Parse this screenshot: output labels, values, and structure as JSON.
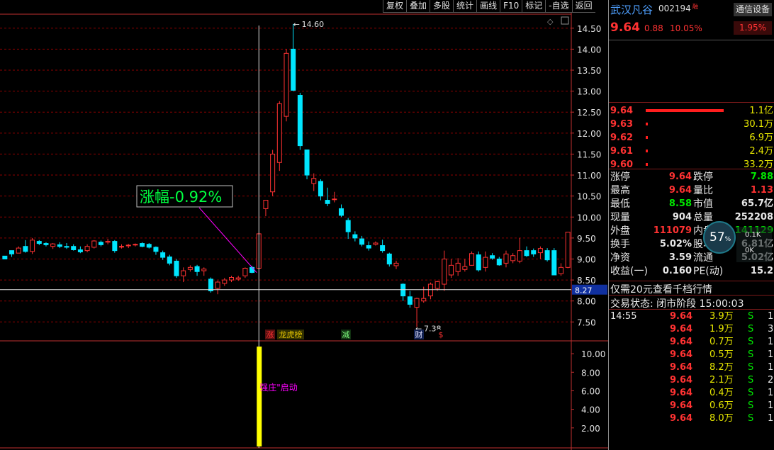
{
  "toolbar": {
    "items": [
      "复权",
      "叠加",
      "多股",
      "统计",
      "画线",
      "F10",
      "标记",
      "-自选",
      "返回"
    ]
  },
  "chart": {
    "price_ticks": [
      "14.50",
      "14.00",
      "13.50",
      "13.00",
      "12.50",
      "12.00",
      "11.50",
      "11.00",
      "10.50",
      "10.00",
      "9.50",
      "9.00",
      "8.50",
      "8.00",
      "7.50"
    ],
    "indicator_ticks": [
      "10.00",
      "8.00",
      "6.00",
      "4.00",
      "2.00"
    ],
    "cursor_price": "8.27",
    "high_label": "14.60",
    "low_label": "7.38",
    "tooltip": "涨幅-0.92%",
    "signal_text": "强庄\"启动",
    "markers": [
      {
        "text": "涨",
        "color": "#ff3232",
        "bg": "#5a1010"
      },
      {
        "text": "龙虎榜",
        "color": "#e0c000",
        "bg": "#303000"
      },
      {
        "text": "减",
        "color": "#80ff80",
        "bg": "#103010"
      },
      {
        "text": "财",
        "color": "#e0e0ff",
        "bg": "#102050"
      },
      {
        "text": "$",
        "color": "#ff3232",
        "bg": "#000000"
      }
    ],
    "colors": {
      "up": "#ff3232",
      "down": "#00e6ff",
      "grid": "#8b0000",
      "bar": "#ffff00",
      "magenta": "#ff00ff"
    },
    "chart_data": {
      "type": "candlestick",
      "candles": [
        [
          9.07,
          9.07,
          9.0,
          9.0
        ],
        [
          9.2,
          9.2,
          9.05,
          9.12
        ],
        [
          9.14,
          9.3,
          9.14,
          9.26
        ],
        [
          9.3,
          9.45,
          9.15,
          9.18
        ],
        [
          9.18,
          9.5,
          9.12,
          9.45
        ],
        [
          9.42,
          9.45,
          9.33,
          9.37
        ],
        [
          9.37,
          9.4,
          9.3,
          9.34
        ],
        [
          9.3,
          9.38,
          9.24,
          9.36
        ],
        [
          9.34,
          9.4,
          9.26,
          9.3
        ],
        [
          9.3,
          9.38,
          9.24,
          9.28
        ],
        [
          9.3,
          9.35,
          9.2,
          9.22
        ],
        [
          9.22,
          9.3,
          9.14,
          9.17
        ],
        [
          9.2,
          9.35,
          9.16,
          9.3
        ],
        [
          9.28,
          9.45,
          9.25,
          9.43
        ],
        [
          9.4,
          9.44,
          9.3,
          9.34
        ],
        [
          9.4,
          9.48,
          9.35,
          9.42
        ],
        [
          9.42,
          9.45,
          9.15,
          9.2
        ],
        [
          9.3,
          9.35,
          9.25,
          9.3
        ],
        [
          9.32,
          9.36,
          9.26,
          9.33
        ],
        [
          9.34,
          9.37,
          9.3,
          9.35
        ],
        [
          9.37,
          9.4,
          9.28,
          9.3
        ],
        [
          9.35,
          9.38,
          9.25,
          9.28
        ],
        [
          9.28,
          9.3,
          9.1,
          9.18
        ],
        [
          9.15,
          9.2,
          8.98,
          9.04
        ],
        [
          9.05,
          9.1,
          8.85,
          8.9
        ],
        [
          8.95,
          9.0,
          8.55,
          8.6
        ],
        [
          8.6,
          8.8,
          8.45,
          8.72
        ],
        [
          8.75,
          8.85,
          8.7,
          8.8
        ],
        [
          8.82,
          8.86,
          8.6,
          8.7
        ],
        [
          8.72,
          8.8,
          8.6,
          8.76
        ],
        [
          8.52,
          8.56,
          8.2,
          8.24
        ],
        [
          8.3,
          8.48,
          8.16,
          8.45
        ],
        [
          8.42,
          8.55,
          8.36,
          8.5
        ],
        [
          8.5,
          8.6,
          8.45,
          8.56
        ],
        [
          8.52,
          8.6,
          8.48,
          8.55
        ],
        [
          8.6,
          8.8,
          8.55,
          8.78
        ],
        [
          8.8,
          8.84,
          8.66,
          8.68
        ],
        [
          8.78,
          9.62,
          8.75,
          9.6
        ],
        [
          10.2,
          10.4,
          10.02,
          10.4
        ],
        [
          10.6,
          11.6,
          10.5,
          11.5
        ],
        [
          11.3,
          12.76,
          11.1,
          12.7
        ],
        [
          12.4,
          14.0,
          12.28,
          13.9
        ],
        [
          14.0,
          14.6,
          13.0,
          13.02
        ],
        [
          12.9,
          12.96,
          11.6,
          11.7
        ],
        [
          11.6,
          11.6,
          10.9,
          11.0
        ],
        [
          10.8,
          11.04,
          10.62,
          10.92
        ],
        [
          10.85,
          10.9,
          10.4,
          10.5
        ],
        [
          10.4,
          10.7,
          10.26,
          10.32
        ],
        [
          10.42,
          10.6,
          10.35,
          10.43
        ],
        [
          10.2,
          10.3,
          10.0,
          10.04
        ],
        [
          9.92,
          9.98,
          9.48,
          9.65
        ],
        [
          9.58,
          9.66,
          9.42,
          9.5
        ],
        [
          9.48,
          9.55,
          9.3,
          9.35
        ],
        [
          9.32,
          9.42,
          9.2,
          9.26
        ],
        [
          9.35,
          9.42,
          9.32,
          9.38
        ],
        [
          9.32,
          9.46,
          9.15,
          9.2
        ],
        [
          9.12,
          9.15,
          8.82,
          8.88
        ],
        [
          8.84,
          8.96,
          8.76,
          8.9
        ],
        [
          8.4,
          8.42,
          8.0,
          8.12
        ],
        [
          8.1,
          8.24,
          7.84,
          7.92
        ],
        [
          7.85,
          8.08,
          7.38,
          8.06
        ],
        [
          8.0,
          8.34,
          7.96,
          8.06
        ],
        [
          8.12,
          8.44,
          8.04,
          8.4
        ],
        [
          8.3,
          8.48,
          8.24,
          8.46
        ],
        [
          8.4,
          9.2,
          8.24,
          9.0
        ],
        [
          8.62,
          9.0,
          8.55,
          8.85
        ],
        [
          8.7,
          9.02,
          8.6,
          8.9
        ],
        [
          8.75,
          9.0,
          8.7,
          8.82
        ],
        [
          8.85,
          9.18,
          8.84,
          9.13
        ],
        [
          9.1,
          9.18,
          8.7,
          8.74
        ],
        [
          8.8,
          9.18,
          8.7,
          9.04
        ],
        [
          9.08,
          9.14,
          8.98,
          9.02
        ],
        [
          9.0,
          9.05,
          8.84,
          8.86
        ],
        [
          8.9,
          9.2,
          8.8,
          9.12
        ],
        [
          8.96,
          9.14,
          8.9,
          9.08
        ],
        [
          8.95,
          9.5,
          8.9,
          9.2
        ],
        [
          9.2,
          9.3,
          9.05,
          9.08
        ],
        [
          9.2,
          9.25,
          9.05,
          9.12
        ],
        [
          9.15,
          9.3,
          9.0,
          9.25
        ],
        [
          9.2,
          9.26,
          8.94,
          8.98
        ],
        [
          9.2,
          9.26,
          8.62,
          8.62
        ],
        [
          8.65,
          8.9,
          8.6,
          8.8
        ],
        [
          8.8,
          9.64,
          8.78,
          9.64
        ]
      ],
      "cursor_index": 37,
      "indicator": {
        "bar_index": 37,
        "bar_value": 10,
        "ylim": [
          0,
          11
        ]
      },
      "ylim": [
        7.1,
        14.8
      ]
    }
  },
  "quote": {
    "name": "武汉凡谷",
    "code": "002194",
    "tag": "融",
    "industry": "通信设备",
    "industry_pct": "1.95%",
    "price": "9.64",
    "change": "0.88",
    "change_pct": "10.05%"
  },
  "orderbook": [
    {
      "price": "9.64",
      "bar": 1.0,
      "vol": "1.1亿"
    },
    {
      "price": "9.63",
      "bar": 0.0,
      "vol": "30.1万"
    },
    {
      "price": "9.62",
      "bar": 0.0,
      "vol": "6.9万"
    },
    {
      "price": "9.61",
      "bar": 0.0,
      "vol": "2.4万"
    },
    {
      "price": "9.60",
      "bar": 0.0,
      "vol": "33.2万"
    }
  ],
  "stats": [
    {
      "l1": "涨停",
      "v1": "9.64",
      "c1": "r",
      "l2": "跌停",
      "v2": "7.88",
      "c2": "g"
    },
    {
      "l1": "最高",
      "v1": "9.64",
      "c1": "r",
      "l2": "量比",
      "v2": "1.13",
      "c2": "r"
    },
    {
      "l1": "最低",
      "v1": "8.58",
      "c1": "g",
      "l2": "市值",
      "v2": "65.7亿",
      "c2": "w"
    },
    {
      "l1": "现量",
      "v1": "904",
      "c1": "w",
      "l2": "总量",
      "v2": "252208",
      "c2": "w"
    },
    {
      "l1": "外盘",
      "v1": "111079",
      "c1": "r",
      "l2": "内盘",
      "v2": "141129",
      "c2": "g"
    },
    {
      "l1": "换手",
      "v1": "5.02%",
      "c1": "w",
      "l2": "股本",
      "v2": "6.81亿",
      "c2": "w"
    },
    {
      "l1": "净资",
      "v1": "3.59",
      "c1": "w",
      "l2": "流通",
      "v2": "5.02亿",
      "c2": "w"
    },
    {
      "l1": "收益(一)",
      "v1": "0.160",
      "c1": "w",
      "l2": "PE(动)",
      "v2": "15.2",
      "c2": "w"
    }
  ],
  "gauge": {
    "value": "57",
    "unit": "%",
    "up": "0.1K",
    "down": "0K"
  },
  "promo": "仅需20元查看千档行情",
  "status": "交易状态: 闭市阶段 15:00:03",
  "ticks": [
    {
      "time": "14:55",
      "price": "9.64",
      "vol": "3.9万",
      "bs": "S",
      "n": "1"
    },
    {
      "time": "",
      "price": "9.64",
      "vol": "1.9万",
      "bs": "S",
      "n": "3"
    },
    {
      "time": "",
      "price": "9.64",
      "vol": "0.7万",
      "bs": "S",
      "n": "1"
    },
    {
      "time": "",
      "price": "9.64",
      "vol": "0.5万",
      "bs": "S",
      "n": "1"
    },
    {
      "time": "",
      "price": "9.64",
      "vol": "8.2万",
      "bs": "S",
      "n": "1"
    },
    {
      "time": "",
      "price": "9.64",
      "vol": "2.1万",
      "bs": "S",
      "n": "2"
    },
    {
      "time": "",
      "price": "9.64",
      "vol": "0.4万",
      "bs": "S",
      "n": "1"
    },
    {
      "time": "",
      "price": "9.64",
      "vol": "0.6万",
      "bs": "S",
      "n": "1"
    },
    {
      "time": "",
      "price": "9.64",
      "vol": "8.0万",
      "bs": "S",
      "n": "1"
    }
  ]
}
